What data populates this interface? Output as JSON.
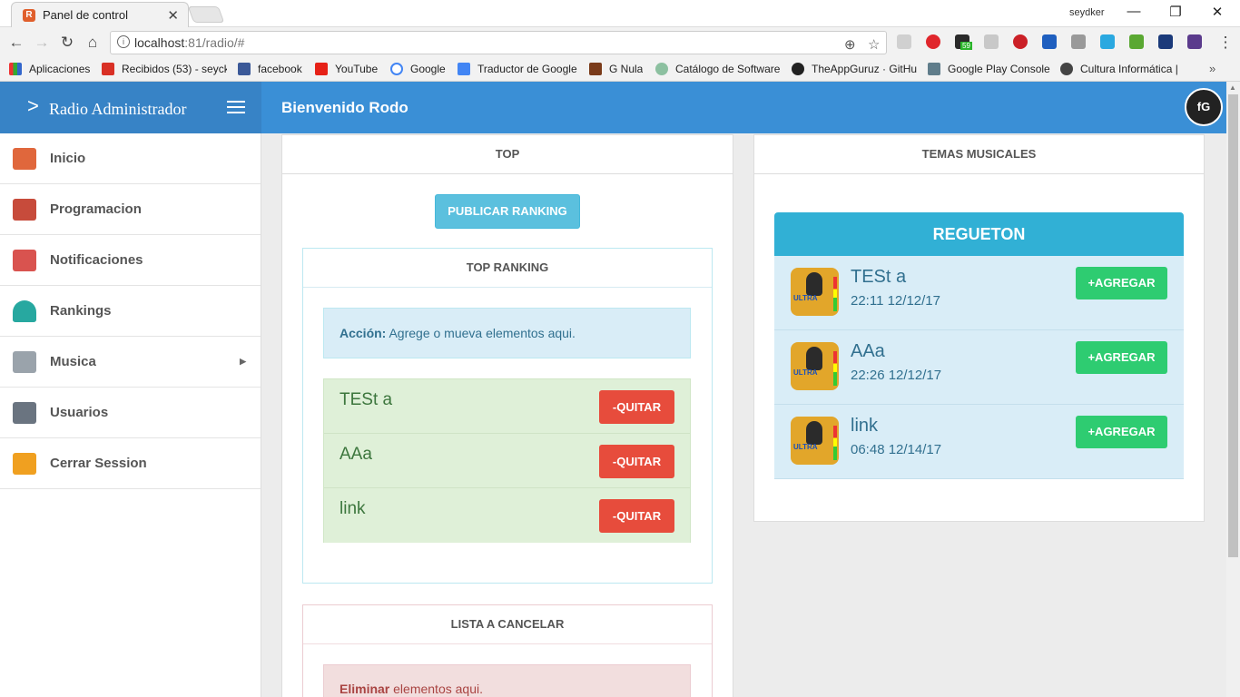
{
  "browser": {
    "tab_title": "Panel de control",
    "user": "seydker",
    "url_host": "localhost",
    "url_rest": ":81/radio/#",
    "bookmarks": [
      "Aplicaciones",
      "Recibidos (53) - seyck",
      "facebook",
      "YouTube",
      "Google",
      "Traductor de Google",
      "G Nula",
      "Catálogo de Software",
      "TheAppGuruz · GitHu",
      "Google Play Console",
      "Cultura Informática |"
    ],
    "ext_badge": "59"
  },
  "header": {
    "brand": "Radio Administrador",
    "welcome": "Bienvenido Rodo"
  },
  "sidebar": {
    "items": [
      {
        "label": "Inicio",
        "icon": "home-icon",
        "color": "#e0673c"
      },
      {
        "label": "Programacion",
        "icon": "calendar-icon",
        "color": "#c74b3b"
      },
      {
        "label": "Notificaciones",
        "icon": "megaphone-icon",
        "color": "#d9534f"
      },
      {
        "label": "Rankings",
        "icon": "gauge-icon",
        "color": "#27a8a0"
      },
      {
        "label": "Musica",
        "icon": "window-icon",
        "color": "#9aa3ab"
      },
      {
        "label": "Usuarios",
        "icon": "id-card-icon",
        "color": "#6a7480"
      },
      {
        "label": "Cerrar Session",
        "icon": "lock-icon",
        "color": "#f0a020"
      }
    ]
  },
  "top": {
    "header": "TOP",
    "publish_button": "PUBLICAR RANKING",
    "ranking_header": "TOP RANKING",
    "alert_strong": "Acción:",
    "alert_text": " Agrege o mueva elementos aqui.",
    "items": [
      {
        "name": "TESt a",
        "button": "-QUITAR"
      },
      {
        "name": "AAa",
        "button": "-QUITAR"
      },
      {
        "name": "link",
        "button": "-QUITAR"
      }
    ],
    "cancel_header": "LISTA A CANCELAR",
    "cancel_strong": "Eliminar",
    "cancel_text": " elementos aqui."
  },
  "music": {
    "header": "TEMAS MUSICALES",
    "genre": "REGUETON",
    "logo_text": "ULTRA",
    "songs": [
      {
        "title": "TESt a",
        "date": "22:11 12/12/17",
        "button": "+AGREGAR"
      },
      {
        "title": "AAa",
        "date": "22:26 12/12/17",
        "button": "+AGREGAR"
      },
      {
        "title": "link",
        "date": "06:48 12/14/17",
        "button": "+AGREGAR"
      }
    ]
  }
}
